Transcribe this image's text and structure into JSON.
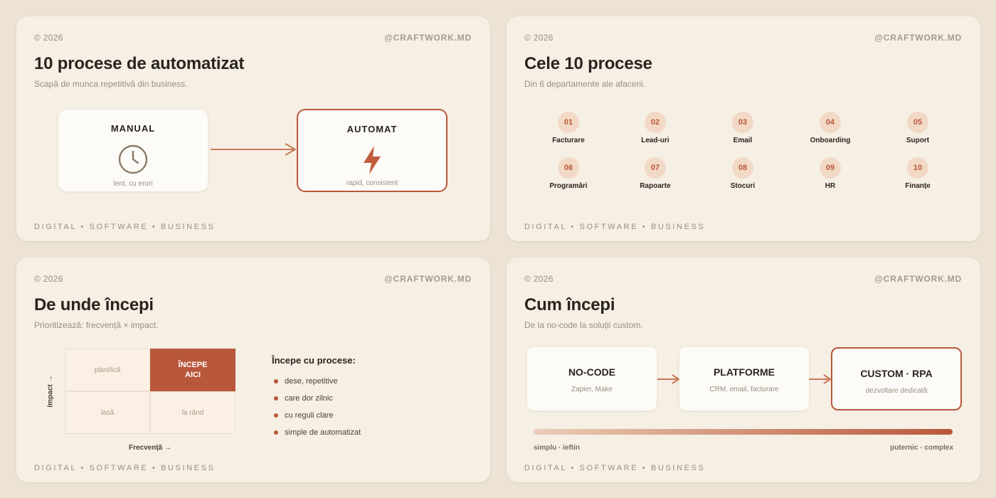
{
  "colors": {
    "background": "#ece3d5",
    "card": "#f5efe4",
    "accent": "#b8573a",
    "accent_light": "#f2d9c6",
    "text": "#2a2420",
    "muted": "#9a8e80"
  },
  "slides": [
    {
      "copyright": "© 2026",
      "handle": "@CRAFTWORK.MD",
      "title": "10 procese de automatizat",
      "subtitle": "Scapă de munca repetitivă din business.",
      "footer": "DIGITAL • SOFTWARE • BUSINESS",
      "manual": {
        "label": "MANUAL",
        "caption": "lent, cu erori",
        "icon": "clock-icon"
      },
      "automat": {
        "label": "AUTOMAT",
        "caption": "rapid, consistent",
        "icon": "lightning-icon"
      }
    },
    {
      "copyright": "© 2026",
      "handle": "@CRAFTWORK.MD",
      "title": "Cele 10 procese",
      "subtitle": "Din 6 departamente ale afacerii.",
      "footer": "DIGITAL • SOFTWARE • BUSINESS",
      "processes": [
        {
          "num": "01",
          "label": "Facturare"
        },
        {
          "num": "02",
          "label": "Lead-uri"
        },
        {
          "num": "03",
          "label": "Email"
        },
        {
          "num": "04",
          "label": "Onboarding"
        },
        {
          "num": "05",
          "label": "Suport"
        },
        {
          "num": "06",
          "label": "Programări"
        },
        {
          "num": "07",
          "label": "Rapoarte"
        },
        {
          "num": "08",
          "label": "Stocuri"
        },
        {
          "num": "09",
          "label": "HR"
        },
        {
          "num": "10",
          "label": "Finanțe"
        }
      ]
    },
    {
      "copyright": "© 2026",
      "handle": "@CRAFTWORK.MD",
      "title": "De unde începi",
      "subtitle": "Prioritizează: frecvență × impact.",
      "footer": "DIGITAL • SOFTWARE • BUSINESS",
      "matrix": {
        "top_left": "planifică",
        "top_right_line1": "ÎNCEPE",
        "top_right_line2": "AICI",
        "bottom_left": "lasă",
        "bottom_right": "la rând",
        "y_axis": "Impact →",
        "x_axis": "Frecvență →"
      },
      "list_title": "Începe cu procese:",
      "list": [
        "dese, repetitive",
        "care dor zilnic",
        "cu reguli clare",
        "simple de automatizat"
      ]
    },
    {
      "copyright": "© 2026",
      "handle": "@CRAFTWORK.MD",
      "title": "Cum începi",
      "subtitle": "De la no-code la soluții custom.",
      "footer": "DIGITAL • SOFTWARE • BUSINESS",
      "steps": [
        {
          "title": "NO-CODE",
          "desc": "Zapier, Make"
        },
        {
          "title": "PLATFORME",
          "desc": "CRM, email, facturare"
        },
        {
          "title": "CUSTOM · RPA",
          "desc": "dezvoltare dedicată"
        }
      ],
      "scale_left": "simplu · ieftin",
      "scale_right": "puternic · complex"
    }
  ]
}
